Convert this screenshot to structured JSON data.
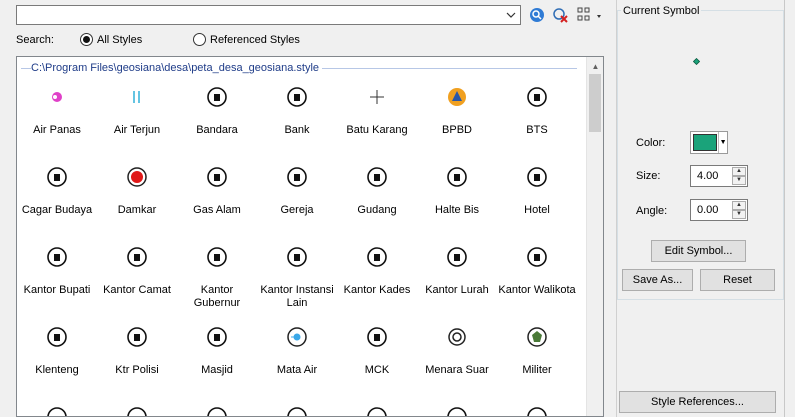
{
  "search": {
    "value": "",
    "placeholder": ""
  },
  "toolbar": {
    "search_icon": "magnify-icon",
    "clear_icon": "clear-search-icon",
    "view_icon": "grid-view-icon"
  },
  "filter": {
    "label": "Search:",
    "options": [
      "All Styles",
      "Referenced Styles"
    ],
    "selected": "All Styles"
  },
  "gallery": {
    "path": "C:\\Program Files\\geosiana\\desa\\peta_desa_geosiana.style",
    "symbols": [
      {
        "label": "Air Panas",
        "icon": "hot-spring-icon"
      },
      {
        "label": "Air Terjun",
        "icon": "waterfall-icon"
      },
      {
        "label": "Bandara",
        "icon": "airplane-icon"
      },
      {
        "label": "Bank",
        "icon": "bank-rp-icon"
      },
      {
        "label": "Batu Karang",
        "icon": "plus-mark-icon"
      },
      {
        "label": "BPBD",
        "icon": "bpbd-icon"
      },
      {
        "label": "BTS",
        "icon": "tower-icon"
      },
      {
        "label": "Cagar Budaya",
        "icon": "monument-icon"
      },
      {
        "label": "Damkar",
        "icon": "fire-station-icon"
      },
      {
        "label": "Gas Alam",
        "icon": "gas-icon"
      },
      {
        "label": "Gereja",
        "icon": "church-icon"
      },
      {
        "label": "Gudang",
        "icon": "warehouse-icon"
      },
      {
        "label": "Halte Bis",
        "icon": "bus-stop-icon"
      },
      {
        "label": "Hotel",
        "icon": "bed-icon"
      },
      {
        "label": "Kantor Bupati",
        "icon": "office-b-icon"
      },
      {
        "label": "Kantor Camat",
        "icon": "office-c-icon"
      },
      {
        "label": "Kantor Gubernur",
        "icon": "office-g-icon"
      },
      {
        "label": "Kantor Instansi Lain",
        "icon": "office-icon"
      },
      {
        "label": "Kantor Kades",
        "icon": "office-d-icon"
      },
      {
        "label": "Kantor Lurah",
        "icon": "office-l-icon"
      },
      {
        "label": "Kantor Walikota",
        "icon": "office-k-icon"
      },
      {
        "label": "Klenteng",
        "icon": "temple-icon"
      },
      {
        "label": "Ktr Polisi",
        "icon": "police-icon"
      },
      {
        "label": "Masjid",
        "icon": "mosque-icon"
      },
      {
        "label": "Mata Air",
        "icon": "spring-icon"
      },
      {
        "label": "MCK",
        "icon": "restroom-icon"
      },
      {
        "label": "Menara Suar",
        "icon": "lighthouse-icon"
      },
      {
        "label": "Militer",
        "icon": "military-icon"
      }
    ]
  },
  "current_symbol": {
    "title": "Current Symbol",
    "color_label": "Color:",
    "color": "#1aa37a",
    "size_label": "Size:",
    "size": "4.00",
    "angle_label": "Angle:",
    "angle": "0.00",
    "edit_label": "Edit Symbol...",
    "saveas_label": "Save As...",
    "reset_label": "Reset",
    "style_refs_label": "Style References..."
  }
}
